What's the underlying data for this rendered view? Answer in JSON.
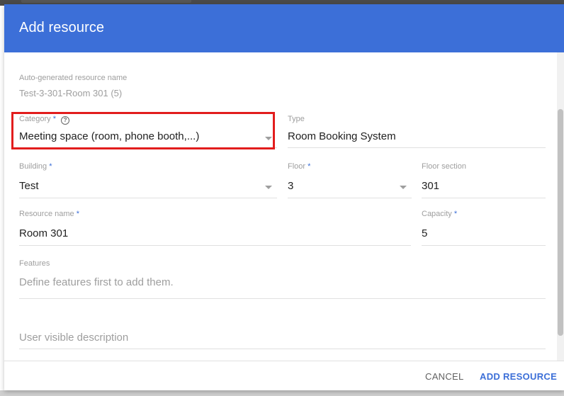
{
  "dialog": {
    "title": "Add resource"
  },
  "auto_name": {
    "label": "Auto-generated resource name",
    "value": "Test-3-301-Room 301 (5)"
  },
  "category": {
    "label": "Category",
    "required_mark": "*",
    "value": "Meeting space (room, phone booth,...)"
  },
  "type": {
    "label": "Type",
    "value": "Room Booking System"
  },
  "building": {
    "label": "Building",
    "required_mark": "*",
    "value": "Test"
  },
  "floor": {
    "label": "Floor",
    "required_mark": "*",
    "value": "3"
  },
  "floor_section": {
    "label": "Floor section",
    "value": "301"
  },
  "resource_name": {
    "label": "Resource name",
    "required_mark": "*",
    "value": "Room 301"
  },
  "capacity": {
    "label": "Capacity",
    "required_mark": "*",
    "value": "5"
  },
  "features": {
    "label": "Features",
    "placeholder": "Define features first to add them."
  },
  "description": {
    "placeholder": "User visible description"
  },
  "footer": {
    "cancel_label": "CANCEL",
    "add_label": "ADD RESOURCE"
  },
  "colors": {
    "header": "#3c6fd8",
    "accent": "#3c6fd8",
    "highlight": "#e21d1d"
  },
  "icons": [
    "help-circle-icon",
    "dropdown-arrow-icon"
  ]
}
